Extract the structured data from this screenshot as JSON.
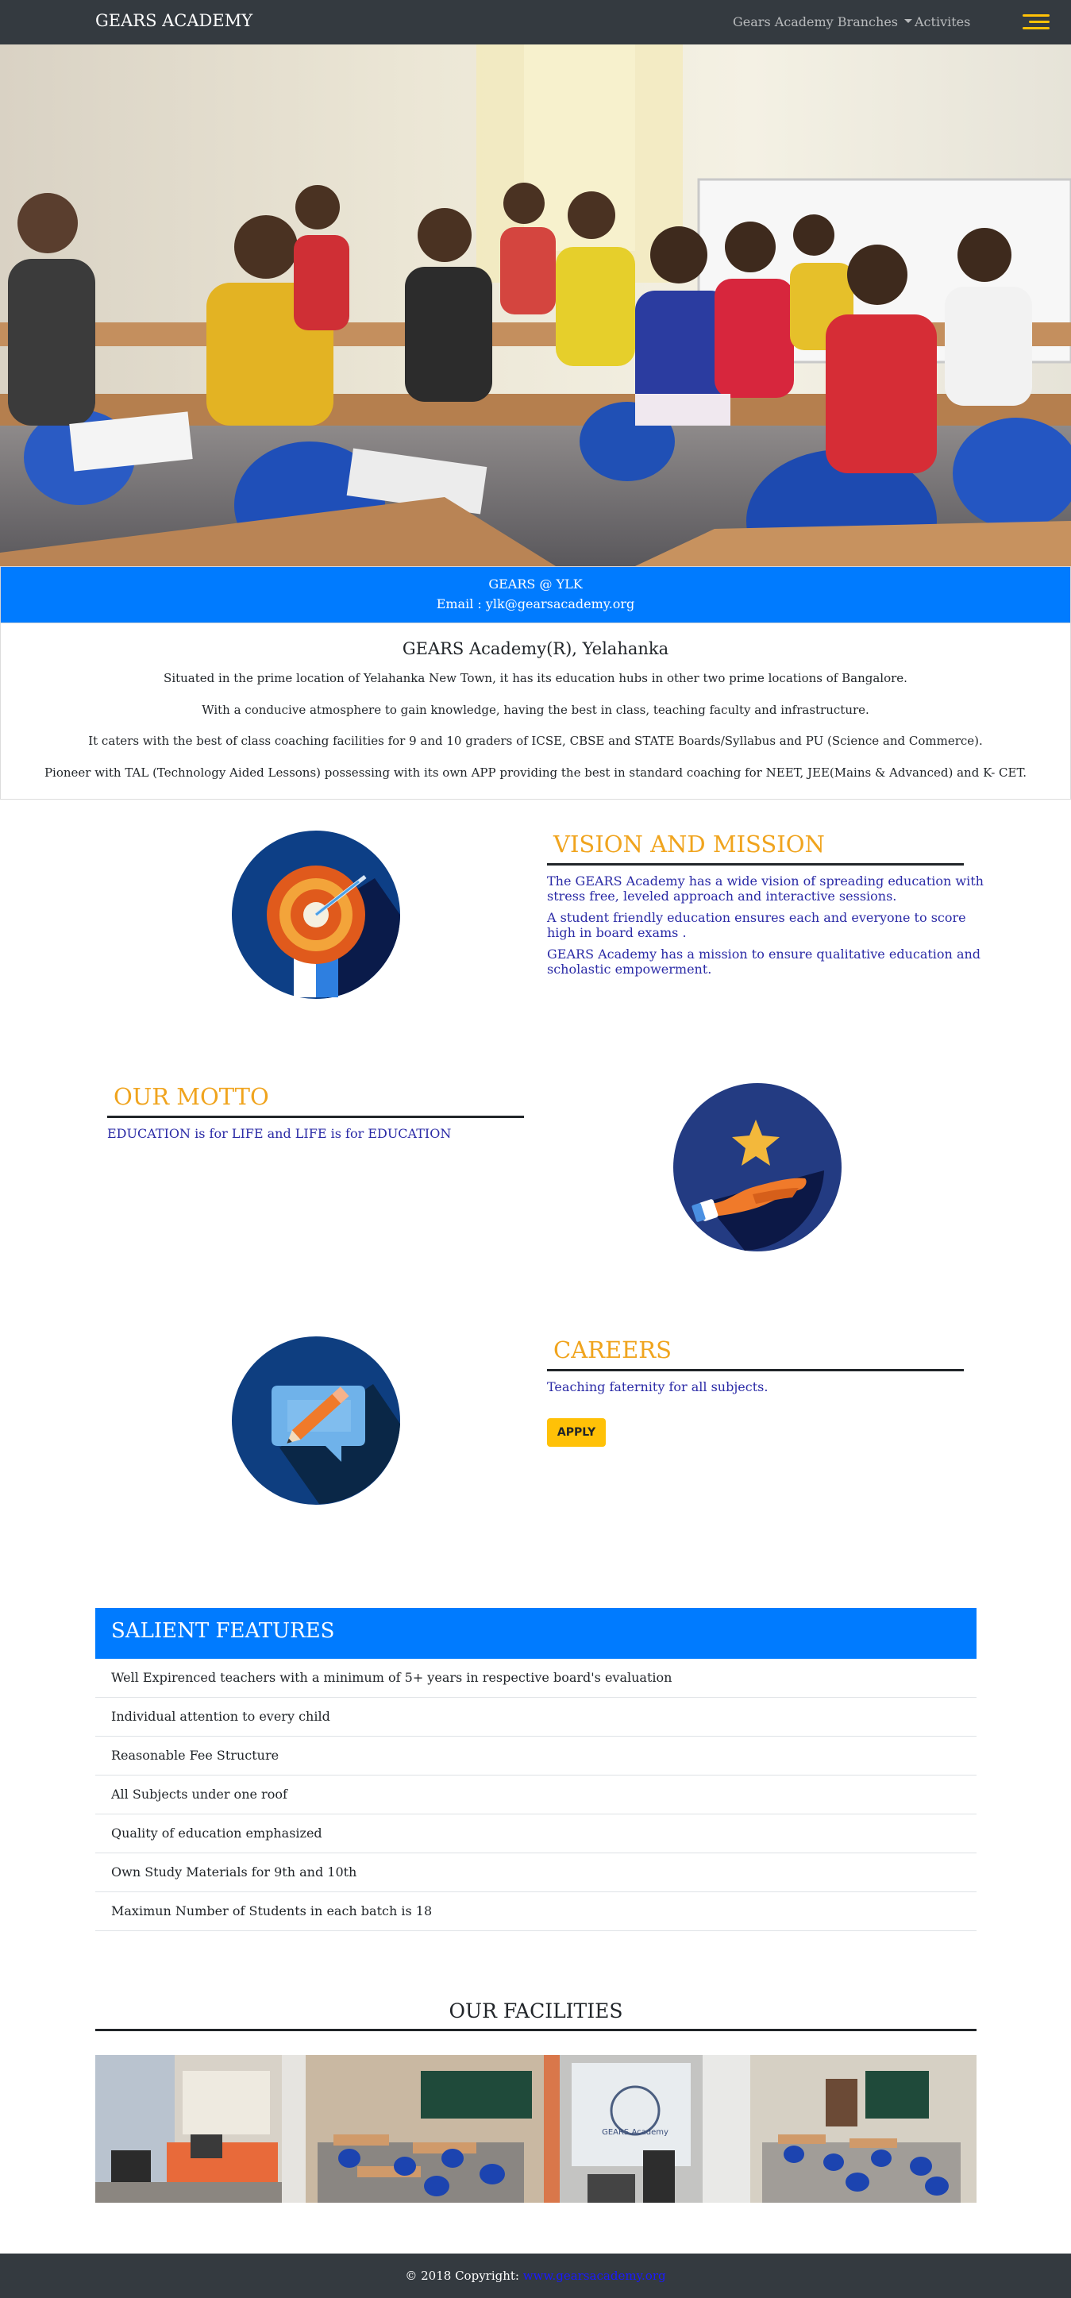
{
  "navbar": {
    "brand": "GEARS ACADEMY",
    "branches_label": "Gears Academy Branches",
    "activities_label": "Activites"
  },
  "contact": {
    "branch": "GEARS @ YLK",
    "email": "Email : ylk@gearsacademy.org"
  },
  "about": {
    "title": "GEARS Academy(R), Yelahanka",
    "paragraphs": [
      "Situated in the prime location of Yelahanka New Town, it has its education hubs in other two prime locations of Bangalore.",
      "With a conducive atmosphere to gain knowledge, having the best in class, teaching faculty and infrastructure.",
      "It caters with the best of class coaching facilities for 9 and 10 graders of ICSE, CBSE and STATE Boards/Syllabus and PU (Science and Commerce).",
      "Pioneer with TAL (Technology Aided Lessons) possessing with its own APP providing the best in standard coaching for NEET, JEE(Mains & Advanced) and K- CET."
    ]
  },
  "vision": {
    "title": "VISION  AND MISSION",
    "lines": [
      "The GEARS Academy has a wide vision of spreading education with",
      "stress free, leveled approach and interactive sessions.",
      "A student friendly education ensures each and everyone to score",
      "high in board exams .",
      "GEARS Academy has a mission to ensure qualitative education and",
      "scholastic empowerment."
    ]
  },
  "motto": {
    "title": "OUR MOTTO",
    "text": "EDUCATION is for LIFE and LIFE is for EDUCATION"
  },
  "careers": {
    "title": "CAREERS",
    "text": "Teaching faternity for all subjects.",
    "apply_label": "APPLY"
  },
  "features": {
    "title": "SALIENT FEATURES",
    "items": [
      "Well Expirenced teachers with a minimum of 5+ years in respective board's evaluation",
      "Individual attention to every child",
      "Reasonable Fee Structure",
      "All Subjects under one roof",
      "Quality of education emphasized",
      "Own Study Materials for 9th and 10th",
      "Maximun Number of Students in each batch is 18"
    ]
  },
  "facilities": {
    "title": "OUR FACILITIES",
    "sign_text": "GEARS Academy"
  },
  "footer": {
    "copyright": "© 2018 Copyright:",
    "link": "www.gearsacademy.org"
  },
  "colors": {
    "navbar": "#343a40",
    "primary_blue": "#007bff",
    "accent_orange": "#f0a41e",
    "text_blue": "#2a2aa6",
    "apply_yellow": "#ffc107"
  }
}
